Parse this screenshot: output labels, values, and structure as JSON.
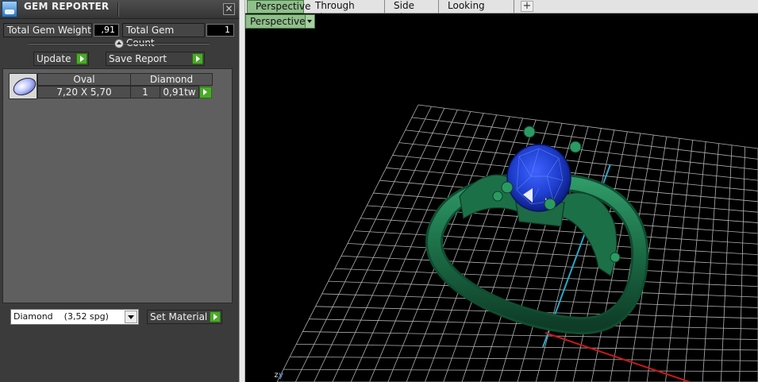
{
  "panel": {
    "title": "GEM REPORTER",
    "close": "✕",
    "total_weight_label": "Total Gem Weight",
    "total_weight_value": ",91",
    "total_count_label": "Total Gem Count",
    "total_count_value": "1",
    "update_label": "Update",
    "save_report_label": "Save Report",
    "gems": [
      {
        "shape": "Oval",
        "type": "Diamond",
        "size": "7,20 X 5,70",
        "count": "1",
        "weight": "0,91tw"
      }
    ],
    "material_selected": "Diamond    (3,52 spg)",
    "set_material_label": "Set Material"
  },
  "viewport": {
    "tabs": [
      {
        "label": "Perspective",
        "active": true
      },
      {
        "label": "Through Finger",
        "active": false
      },
      {
        "label": "Side View",
        "active": false
      },
      {
        "label": "Looking Down",
        "active": false
      }
    ],
    "add_tab": "+",
    "view_mode": "Perspective",
    "axis_z": "z",
    "axis_y": "y"
  },
  "colors": {
    "ring_metal": "#1f7a4f",
    "gem": "#1f3fd0",
    "grid": "#cfcfcf",
    "axis_red": "#c81818",
    "axis_cyan": "#2aa7c8",
    "active_tab": "#8fbf8a",
    "play_button": "#4caa2a"
  }
}
